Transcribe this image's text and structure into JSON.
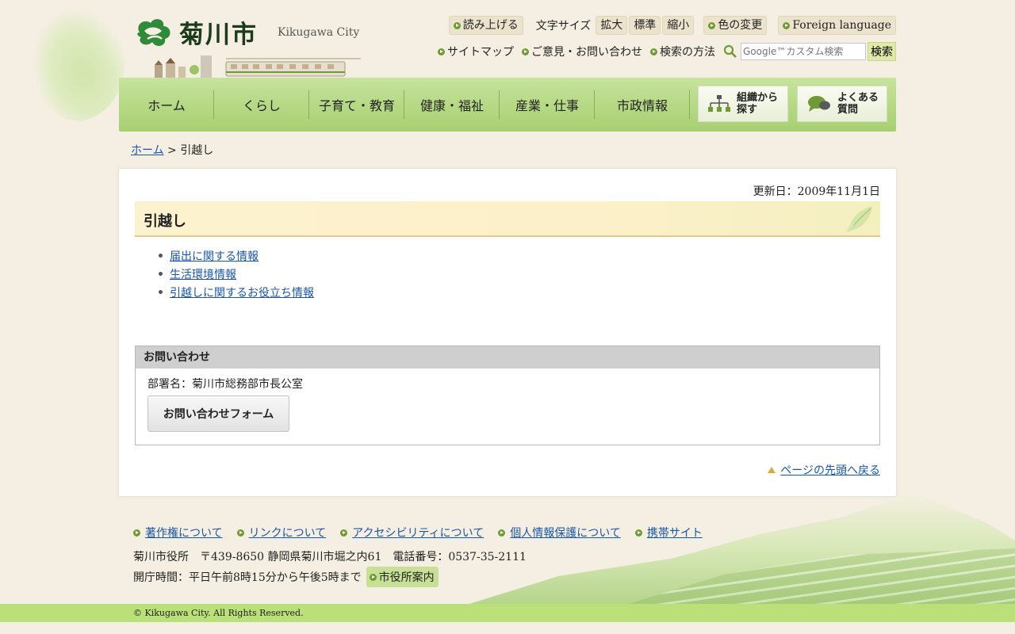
{
  "header": {
    "logo_text": "菊川市",
    "logo_en": "Kikugawa City",
    "read_aloud": "読み上げる",
    "font_size_label": "文字サイズ",
    "font_size_buttons": [
      "拡大",
      "標準",
      "縮小"
    ],
    "color_change": "色の変更",
    "foreign_language": "Foreign language",
    "sitemap": "サイトマップ",
    "feedback": "ご意見・お問い合わせ",
    "search_help": "検索の方法",
    "search_placeholder": "Google™カスタム検索",
    "search_button": "検索"
  },
  "nav": {
    "items": [
      "ホーム",
      "くらし",
      "子育て・教育",
      "健康・福祉",
      "産業・仕事",
      "市政情報"
    ],
    "org_button": [
      "組織から",
      "探す"
    ],
    "faq_button": [
      "よくある",
      "質問"
    ]
  },
  "breadcrumb": {
    "home": "ホーム",
    "separator": ">",
    "current": "引越し"
  },
  "main": {
    "updated": "更新日：2009年11月1日",
    "title": "引越し",
    "links": [
      "届出に関する情報",
      "生活環境情報",
      "引越しに関するお役立ち情報"
    ],
    "contact": {
      "heading": "お問い合わせ",
      "department": "部署名：菊川市総務部市長公室",
      "form_button": "お問い合わせフォーム"
    },
    "page_top": "ページの先頭へ戻る"
  },
  "footer": {
    "links": [
      "著作権について",
      "リンクについて",
      "アクセシビリティについて",
      "個人情報保護について",
      "携帯サイト"
    ],
    "address": "菊川市役所　〒439-8650 静岡県菊川市堀之内61　電話番号：0537-35-2111",
    "hours": "開庁時間：平日午前8時15分から午後5時まで",
    "office_guide": "市役所案内",
    "copyright": "© Kikugawa City. All Rights Reserved."
  },
  "colors": {
    "background": "#f4efe2",
    "nav_green": "#b5d884",
    "link_blue": "#1a55a6",
    "title_band": "#fdf2cf",
    "copyright_bar": "#bbe07a"
  }
}
